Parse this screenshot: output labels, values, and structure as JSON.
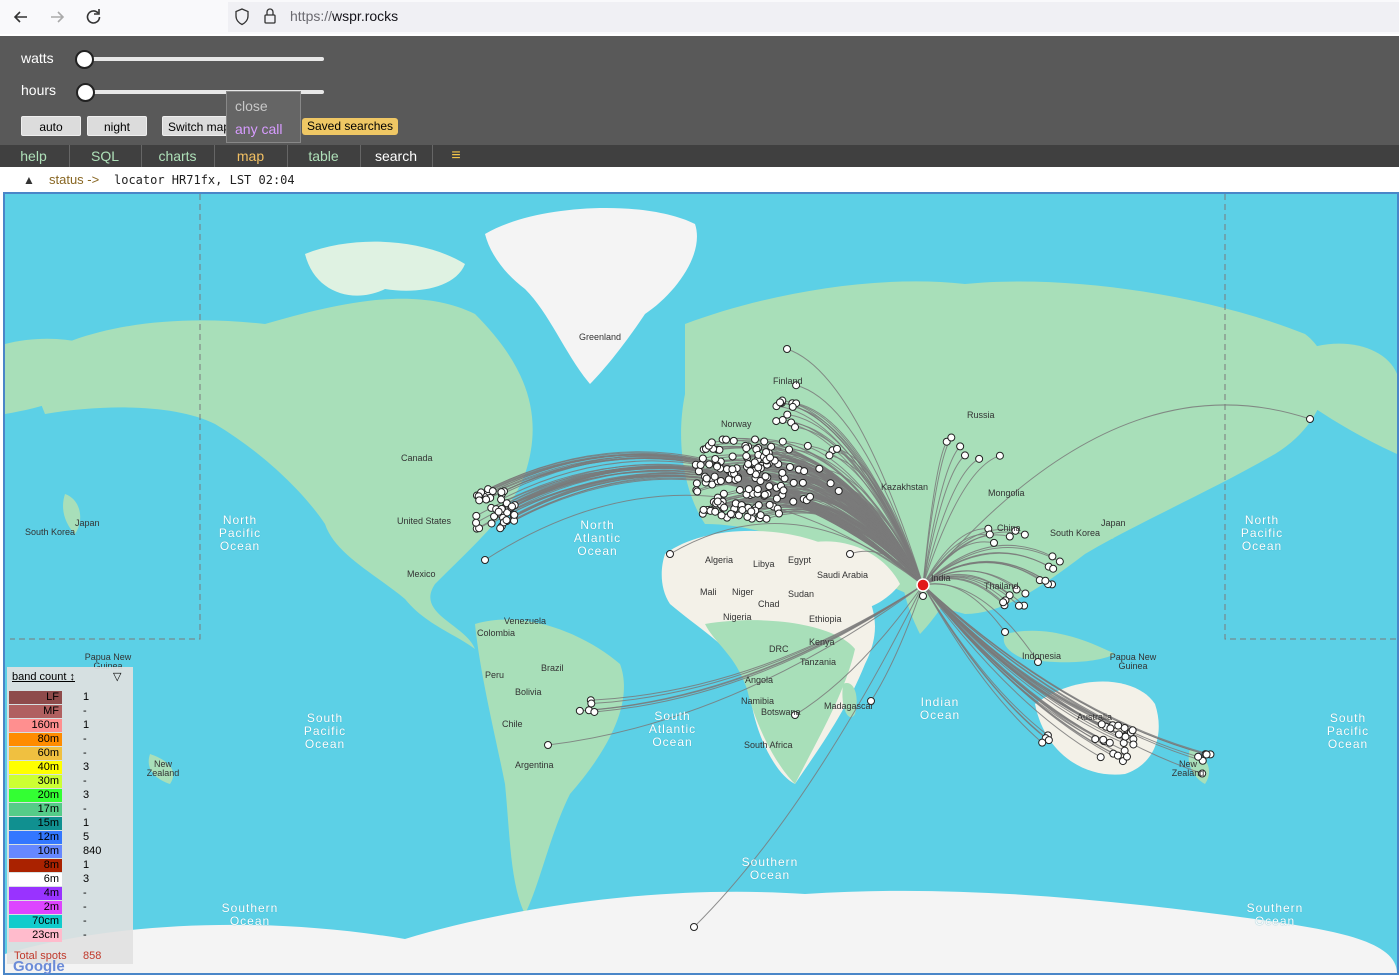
{
  "browser": {
    "url_scheme": "https://",
    "url_host": "wspr.rocks"
  },
  "controls": {
    "watts_label": "watts",
    "hours_label": "hours",
    "auto_label": "auto",
    "night_label": "night",
    "switch_map_label": "Switch map",
    "saved_searches_label": "Saved searches",
    "popup": {
      "close_label": "close",
      "any_call_label": "any call"
    }
  },
  "menu": {
    "items": [
      {
        "label": "help"
      },
      {
        "label": "SQL"
      },
      {
        "label": "charts"
      },
      {
        "label": "map"
      },
      {
        "label": "table"
      },
      {
        "label": "search"
      }
    ],
    "hamburger": "≡"
  },
  "status": {
    "toggle": "▲",
    "label": "status ->",
    "text": "locator HR71fx, LST 02:04"
  },
  "map": {
    "place_labels": [
      "Greenland",
      "Finland",
      "Norway",
      "Russia",
      "Canada",
      "Kazakhstan",
      "Mongolia",
      "Japan",
      "South Korea",
      "United States",
      "China",
      "South Korea",
      "Japan",
      "Mexico",
      "Algeria",
      "Libya",
      "Egypt",
      "Saudi Arabia",
      "India",
      "Thailand",
      "Mali",
      "Niger",
      "Sudan",
      "Chad",
      "Nigeria",
      "Ethiopia",
      "Venezuela",
      "Colombia",
      "Kenya",
      "Tanzania",
      "DRC",
      "Indonesia",
      "Papua New Guinea",
      "Papua New Guinea",
      "Brazil",
      "Peru",
      "Bolivia",
      "Angola",
      "Namibia",
      "Botswana",
      "Madagascar",
      "Chile",
      "Australia",
      "South Africa",
      "New Zealand",
      "Argentina",
      "New Zealand"
    ],
    "ocean_labels": [
      "North Pacific Ocean",
      "North Atlantic Ocean",
      "North Pacific Ocean",
      "South Pacific Ocean",
      "South Atlantic Ocean",
      "Indian Ocean",
      "South Pacific Ocean",
      "Southern Ocean",
      "Southern Ocean",
      "Southern Ocean"
    ],
    "attribution": "Google",
    "colors": {
      "ocean": "#5cd0e6",
      "land": "#a8dfb9",
      "desert": "#f3f1e8",
      "ice": "#f4f4f4",
      "path": "#7a7a7a",
      "spot": "#ffffff",
      "home": "#e11a1a"
    }
  },
  "legend": {
    "header": "band count ↕",
    "filter_icon": "▽",
    "bands": [
      {
        "name": "LF",
        "count": "1",
        "color": "#8e4b4b"
      },
      {
        "name": "MF",
        "count": "-",
        "color": "#b06060"
      },
      {
        "name": "160m",
        "count": "1",
        "color": "#ff8f8f"
      },
      {
        "name": "80m",
        "count": "-",
        "color": "#ff8c00"
      },
      {
        "name": "60m",
        "count": "-",
        "color": "#f0c040"
      },
      {
        "name": "40m",
        "count": "3",
        "color": "#ffff00"
      },
      {
        "name": "30m",
        "count": "-",
        "color": "#ccff33"
      },
      {
        "name": "20m",
        "count": "3",
        "color": "#33ff33"
      },
      {
        "name": "17m",
        "count": "-",
        "color": "#55cc88"
      },
      {
        "name": "15m",
        "count": "1",
        "color": "#109090"
      },
      {
        "name": "12m",
        "count": "5",
        "color": "#3377ff"
      },
      {
        "name": "10m",
        "count": "840",
        "color": "#6688ff"
      },
      {
        "name": "8m",
        "count": "1",
        "color": "#aa2200"
      },
      {
        "name": "6m",
        "count": "3",
        "color": "#ffffff"
      },
      {
        "name": "4m",
        "count": "-",
        "color": "#9933ff"
      },
      {
        "name": "2m",
        "count": "-",
        "color": "#dd44ff"
      },
      {
        "name": "70cm",
        "count": "-",
        "color": "#11cccc"
      },
      {
        "name": "23cm",
        "count": "-",
        "color": "#ffbbcc"
      }
    ],
    "total_label": "Total spots",
    "total_value": "858"
  }
}
